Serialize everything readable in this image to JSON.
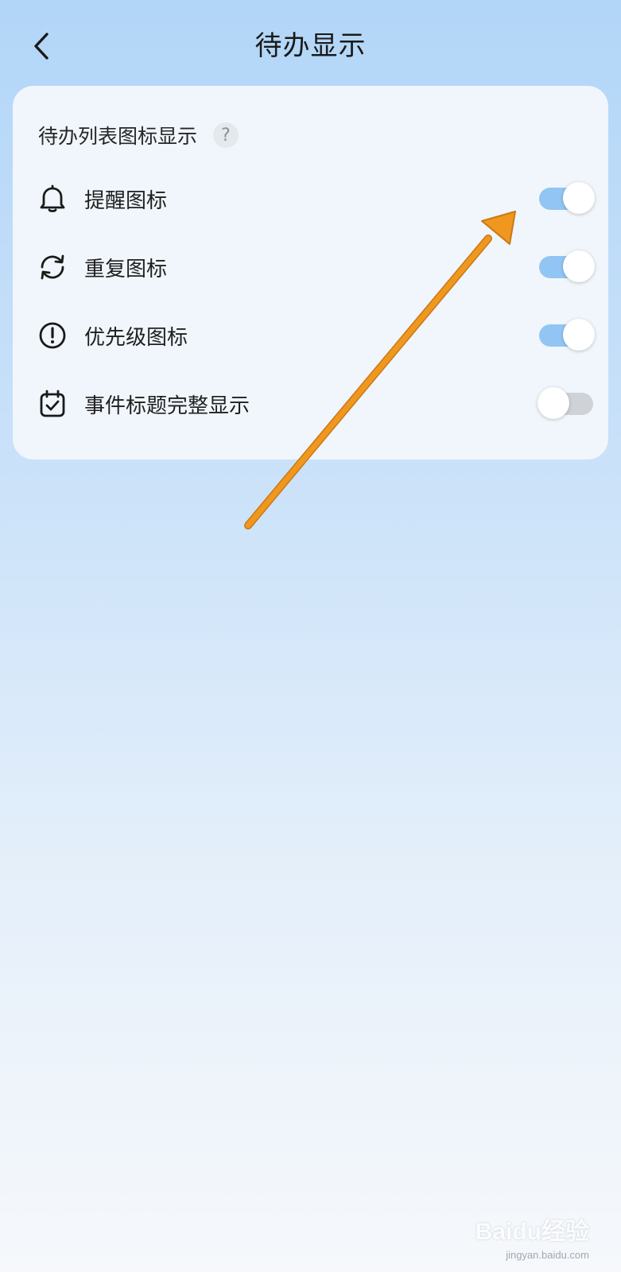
{
  "header": {
    "title": "待办显示",
    "back_icon": "chevron-left-icon"
  },
  "section": {
    "title": "待办列表图标显示",
    "help_glyph": "?"
  },
  "rows": [
    {
      "label": "提醒图标",
      "icon": "bell-icon",
      "enabled": true
    },
    {
      "label": "重复图标",
      "icon": "repeat-icon",
      "enabled": true
    },
    {
      "label": "优先级图标",
      "icon": "priority-icon",
      "enabled": true
    },
    {
      "label": "事件标题完整显示",
      "icon": "calendar-check-icon",
      "enabled": false
    }
  ],
  "colors": {
    "toggle_on": "#92c5f4",
    "toggle_off": "#cfd3d7",
    "annotation_arrow": "#f0971e"
  },
  "watermark": {
    "brand": "Baidu经验",
    "url": "jingyan.baidu.com"
  }
}
